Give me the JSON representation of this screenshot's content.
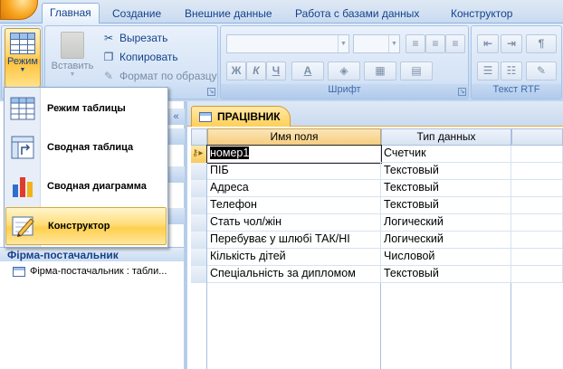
{
  "tabs": [
    "Главная",
    "Создание",
    "Внешние данные",
    "Работа с базами данных",
    "Конструктор"
  ],
  "ribbon": {
    "mode_label": "Режим",
    "paste_label": "Вставить",
    "cut_label": "Вырезать",
    "copy_label": "Копировать",
    "format_painter_label": "Формат по образцу",
    "font_group_label": "Шрифт",
    "rtf_group_label": "Текст RTF",
    "bold": "Ж",
    "italic": "К",
    "underline": "Ч",
    "font_color_glyph": "A"
  },
  "view_menu": {
    "items": [
      {
        "label": "Режим таблицы",
        "icon": "datasheet-view-icon"
      },
      {
        "label": "Сводная таблица",
        "icon": "pivot-table-icon"
      },
      {
        "label": "Сводная диаграмма",
        "icon": "pivot-chart-icon"
      },
      {
        "label": "Конструктор",
        "icon": "design-view-icon",
        "active": true
      }
    ]
  },
  "nav": {
    "collapse_glyph": "«",
    "group_label": "Фірма-постачальник",
    "item_label": "Фірма-постачальник : табли..."
  },
  "document": {
    "tab_title": "ПРАЦІВНИК"
  },
  "design_grid": {
    "headers": [
      "Имя поля",
      "Тип данных"
    ],
    "rows": [
      {
        "field": "номер1",
        "type": "Счетчик",
        "key": true,
        "selected": true
      },
      {
        "field": "ПІБ",
        "type": "Текстовый"
      },
      {
        "field": "Адреса",
        "type": "Текстовый"
      },
      {
        "field": "Телефон",
        "type": "Текстовый"
      },
      {
        "field": "Стать чол/жін",
        "type": "Логический"
      },
      {
        "field": "Перебуває у шлюбі ТАК/НІ",
        "type": "Логический"
      },
      {
        "field": "Кількість дітей",
        "type": "Числовой"
      },
      {
        "field": "Спеціальність за дипломом",
        "type": "Текстовый"
      }
    ]
  },
  "colors": {
    "accent": "#ffcf57",
    "ribbon_text": "#15428b",
    "key_selector": "#f9c95c"
  }
}
